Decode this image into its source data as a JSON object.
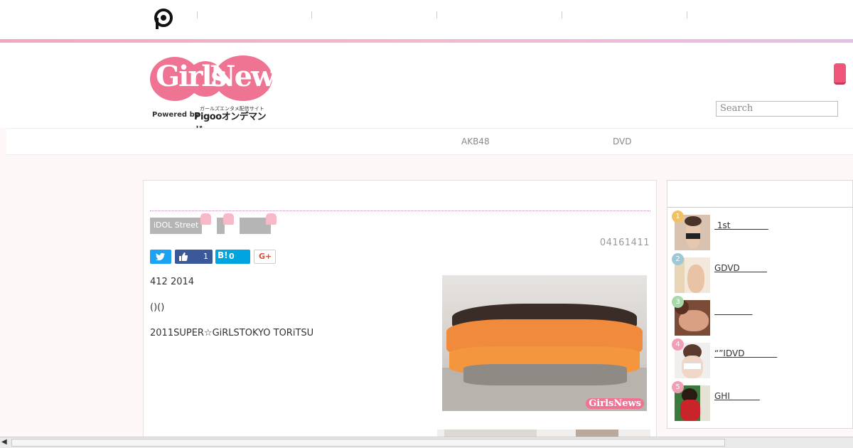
{
  "topbar": {
    "logo_icon": "pigoo-p-icon"
  },
  "header": {
    "logo": {
      "word_1": "Girls",
      "word_2": "News",
      "kana": "ガールズエンタメ配信サイト",
      "powered_by": "Powered by",
      "pigoo": "Pigooオンデマンド"
    },
    "search_placeholder": "Search"
  },
  "nav": {
    "items": [
      "AKB48",
      "DVD"
    ]
  },
  "article": {
    "tags": [
      "iDOL Street"
    ],
    "date": "04161411",
    "share": {
      "twitter_icon": "twitter-icon",
      "facebook_count": "1",
      "hatena_label": "B!",
      "hatena_count": "0",
      "gplus_label": "G+"
    },
    "paragraphs": [
      "412 2014",
      "()()",
      "2011SUPER☆GiRLSTOKYO TORiTSU"
    ],
    "photo_watermark": "GirlsNews"
  },
  "sidebar": {
    "ranking": [
      {
        "rank": "1",
        "title": " 1st              ",
        "color": "#f1c164"
      },
      {
        "rank": "2",
        "title": "GDVD          ",
        "color": "#9cc8d8"
      },
      {
        "rank": "3",
        "title": "              ",
        "color": "#a6d9a8"
      },
      {
        "rank": "4",
        "title": "“”IDVD            ",
        "color": "#f19fb6"
      },
      {
        "rank": "5",
        "title": "GHI           ",
        "color": "#f19fb6"
      }
    ]
  },
  "colors": {
    "brand_pink": "#ef7392",
    "accent_button": "#f0557a"
  }
}
